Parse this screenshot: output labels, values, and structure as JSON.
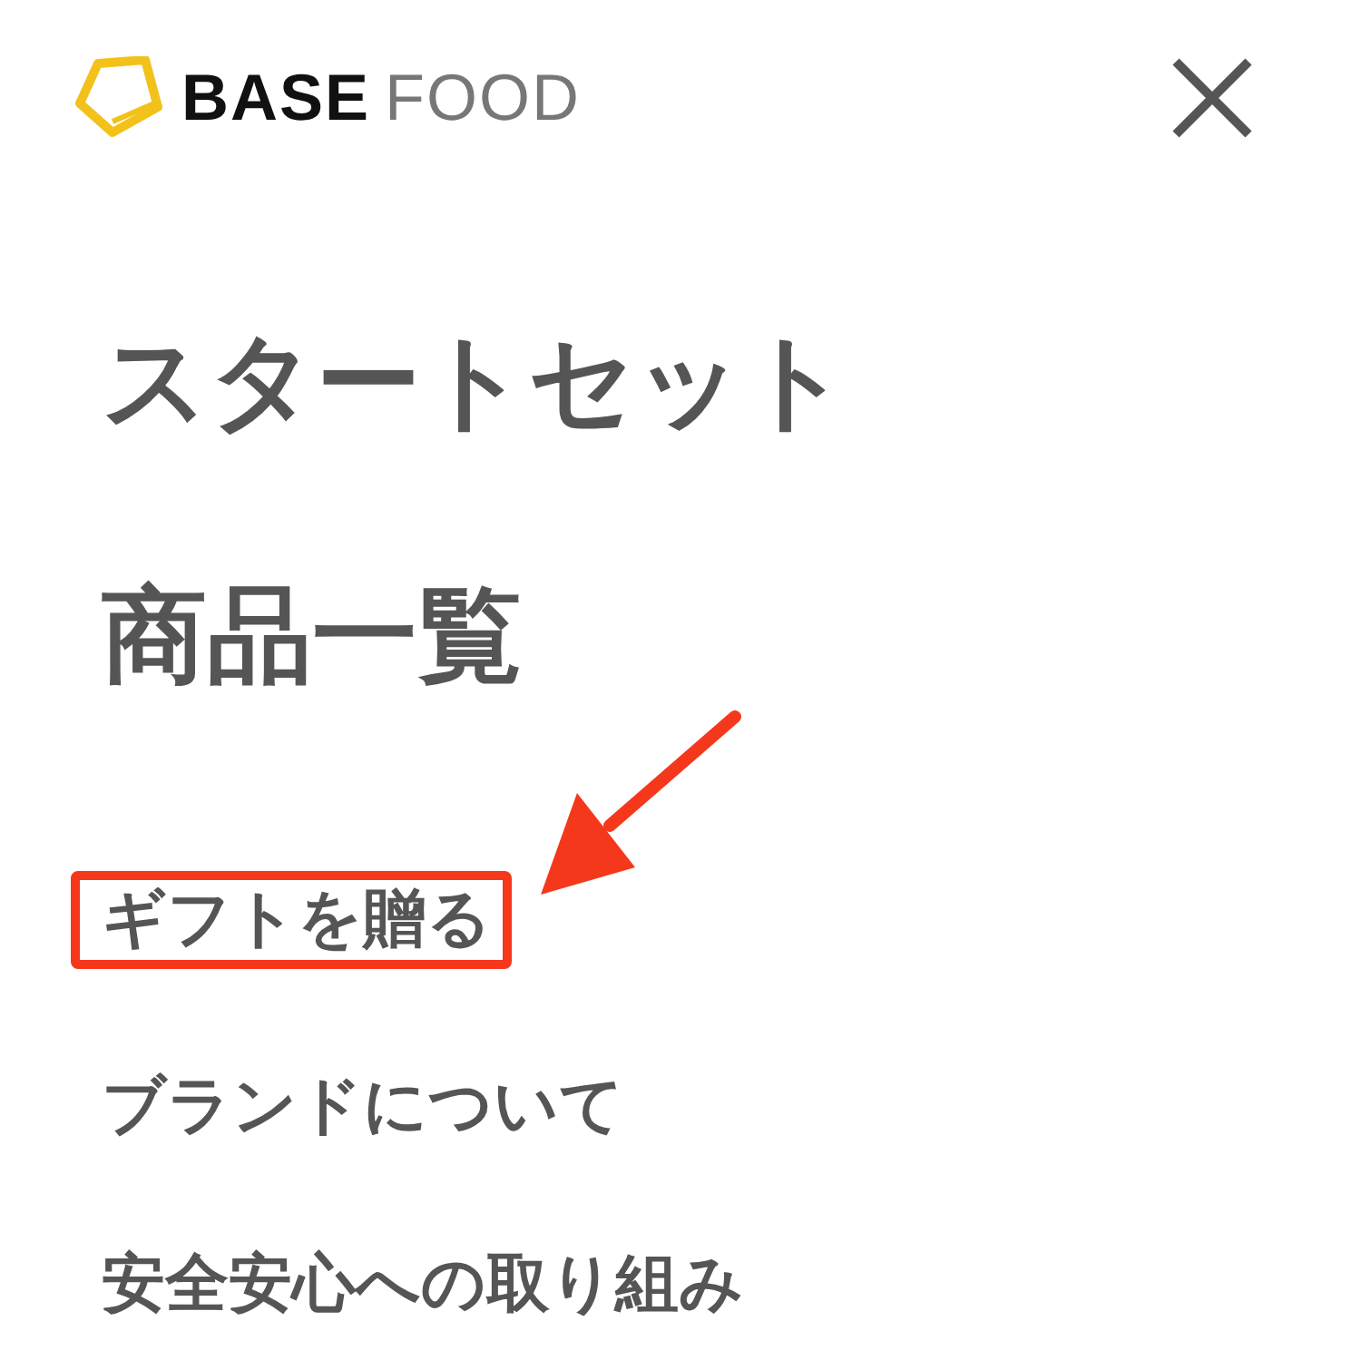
{
  "header": {
    "logo": {
      "strong": "BASE",
      "light": "FOOD"
    }
  },
  "menu": [
    {
      "label": "スタートセット",
      "kind": "large",
      "highlighted": false
    },
    {
      "label": "商品一覧",
      "kind": "large",
      "highlighted": false
    },
    {
      "label": "ギフトを贈る",
      "kind": "small",
      "highlighted": true
    },
    {
      "label": "ブランドについて",
      "kind": "small",
      "highlighted": false
    },
    {
      "label": "安全安心への取り組み",
      "kind": "small",
      "highlighted": false
    }
  ]
}
